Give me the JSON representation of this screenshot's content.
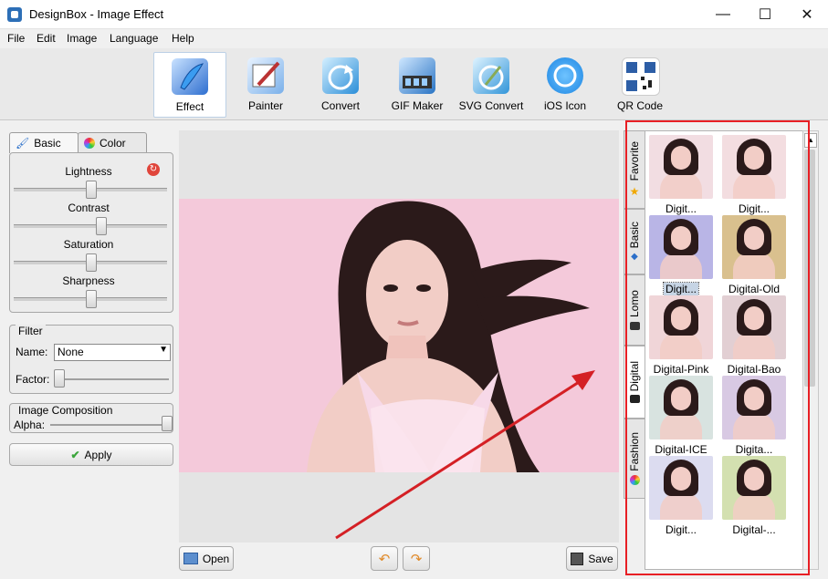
{
  "window": {
    "title": "DesignBox - Image Effect",
    "minimize_glyph": "—",
    "maximize_glyph": "☐",
    "close_glyph": "✕"
  },
  "menu": [
    "File",
    "Edit",
    "Image",
    "Language",
    "Help"
  ],
  "toolbar": [
    {
      "label": "Effect",
      "icon": "effect-icon",
      "color": "#2f6fd0",
      "active": true
    },
    {
      "label": "Painter",
      "icon": "painter-icon",
      "color": "#3a7fd6",
      "active": false
    },
    {
      "label": "Convert",
      "icon": "convert-icon",
      "color": "#2b8ed8",
      "active": false
    },
    {
      "label": "GIF Maker",
      "icon": "gif-maker-icon",
      "color": "#2a74c4",
      "active": false
    },
    {
      "label": "SVG Convert",
      "icon": "svg-convert-icon",
      "color": "#3295d9",
      "active": false
    },
    {
      "label": "iOS Icon",
      "icon": "ios-icon-icon",
      "color": "#1c86e3",
      "active": false
    },
    {
      "label": "QR Code",
      "icon": "qr-code-icon",
      "color": "#2d5ea6",
      "active": false
    }
  ],
  "left_tabs": [
    {
      "label": "Basic",
      "icon": "brush-icon"
    },
    {
      "label": "Color",
      "icon": "color-wheel-icon"
    }
  ],
  "adjustments": [
    {
      "label": "Lightness",
      "value": 0.5
    },
    {
      "label": "Contrast",
      "value": 0.57
    },
    {
      "label": "Saturation",
      "value": 0.5
    },
    {
      "label": "Sharpness",
      "value": 0.5
    }
  ],
  "filter": {
    "legend": "Filter",
    "name_label": "Name:",
    "name_value": "None",
    "factor_label": "Factor:",
    "factor_value": 0.0
  },
  "composition": {
    "legend": "Image Composition",
    "alpha_label": "Alpha:",
    "alpha_value": 1.0
  },
  "apply_label": "Apply",
  "bottom": {
    "open_label": "Open",
    "save_label": "Save"
  },
  "side_tabs": [
    {
      "label": "Favorite",
      "icon": "star-icon"
    },
    {
      "label": "Basic",
      "icon": "brush-icon"
    },
    {
      "label": "Lomo",
      "icon": "camera-icon"
    },
    {
      "label": "Digital",
      "icon": "digital-camera-icon",
      "selected": true
    },
    {
      "label": "Fashion",
      "icon": "color-wheel-icon"
    }
  ],
  "thumbnails": [
    {
      "label": "Digit...",
      "tint": "#f2dde2",
      "selected": false
    },
    {
      "label": "Digit...",
      "tint": "#f3dde0",
      "selected": false
    },
    {
      "label": "Digit...",
      "tint": "#b9b5e6",
      "selected": true
    },
    {
      "label": "Digital-Old",
      "tint": "#d9c08e",
      "selected": false
    },
    {
      "label": "Digital-Pink",
      "tint": "#f0d5d8",
      "selected": false
    },
    {
      "label": "Digital-Bao",
      "tint": "#e2cfd3",
      "selected": false
    },
    {
      "label": "Digital-ICE",
      "tint": "#d8e3e0",
      "selected": false
    },
    {
      "label": "Digita...",
      "tint": "#d8c9e3",
      "selected": false
    },
    {
      "label": "Digit...",
      "tint": "#dcdcf0",
      "selected": false
    },
    {
      "label": "Digital-...",
      "tint": "#d3e0b0",
      "selected": false
    }
  ],
  "colors": {
    "highlight_box": "#e81f25",
    "arrow": "#d42025",
    "photo_bg": "#f4c9da",
    "hair": "#2b1a1a",
    "skin": "#f2cdc6"
  }
}
